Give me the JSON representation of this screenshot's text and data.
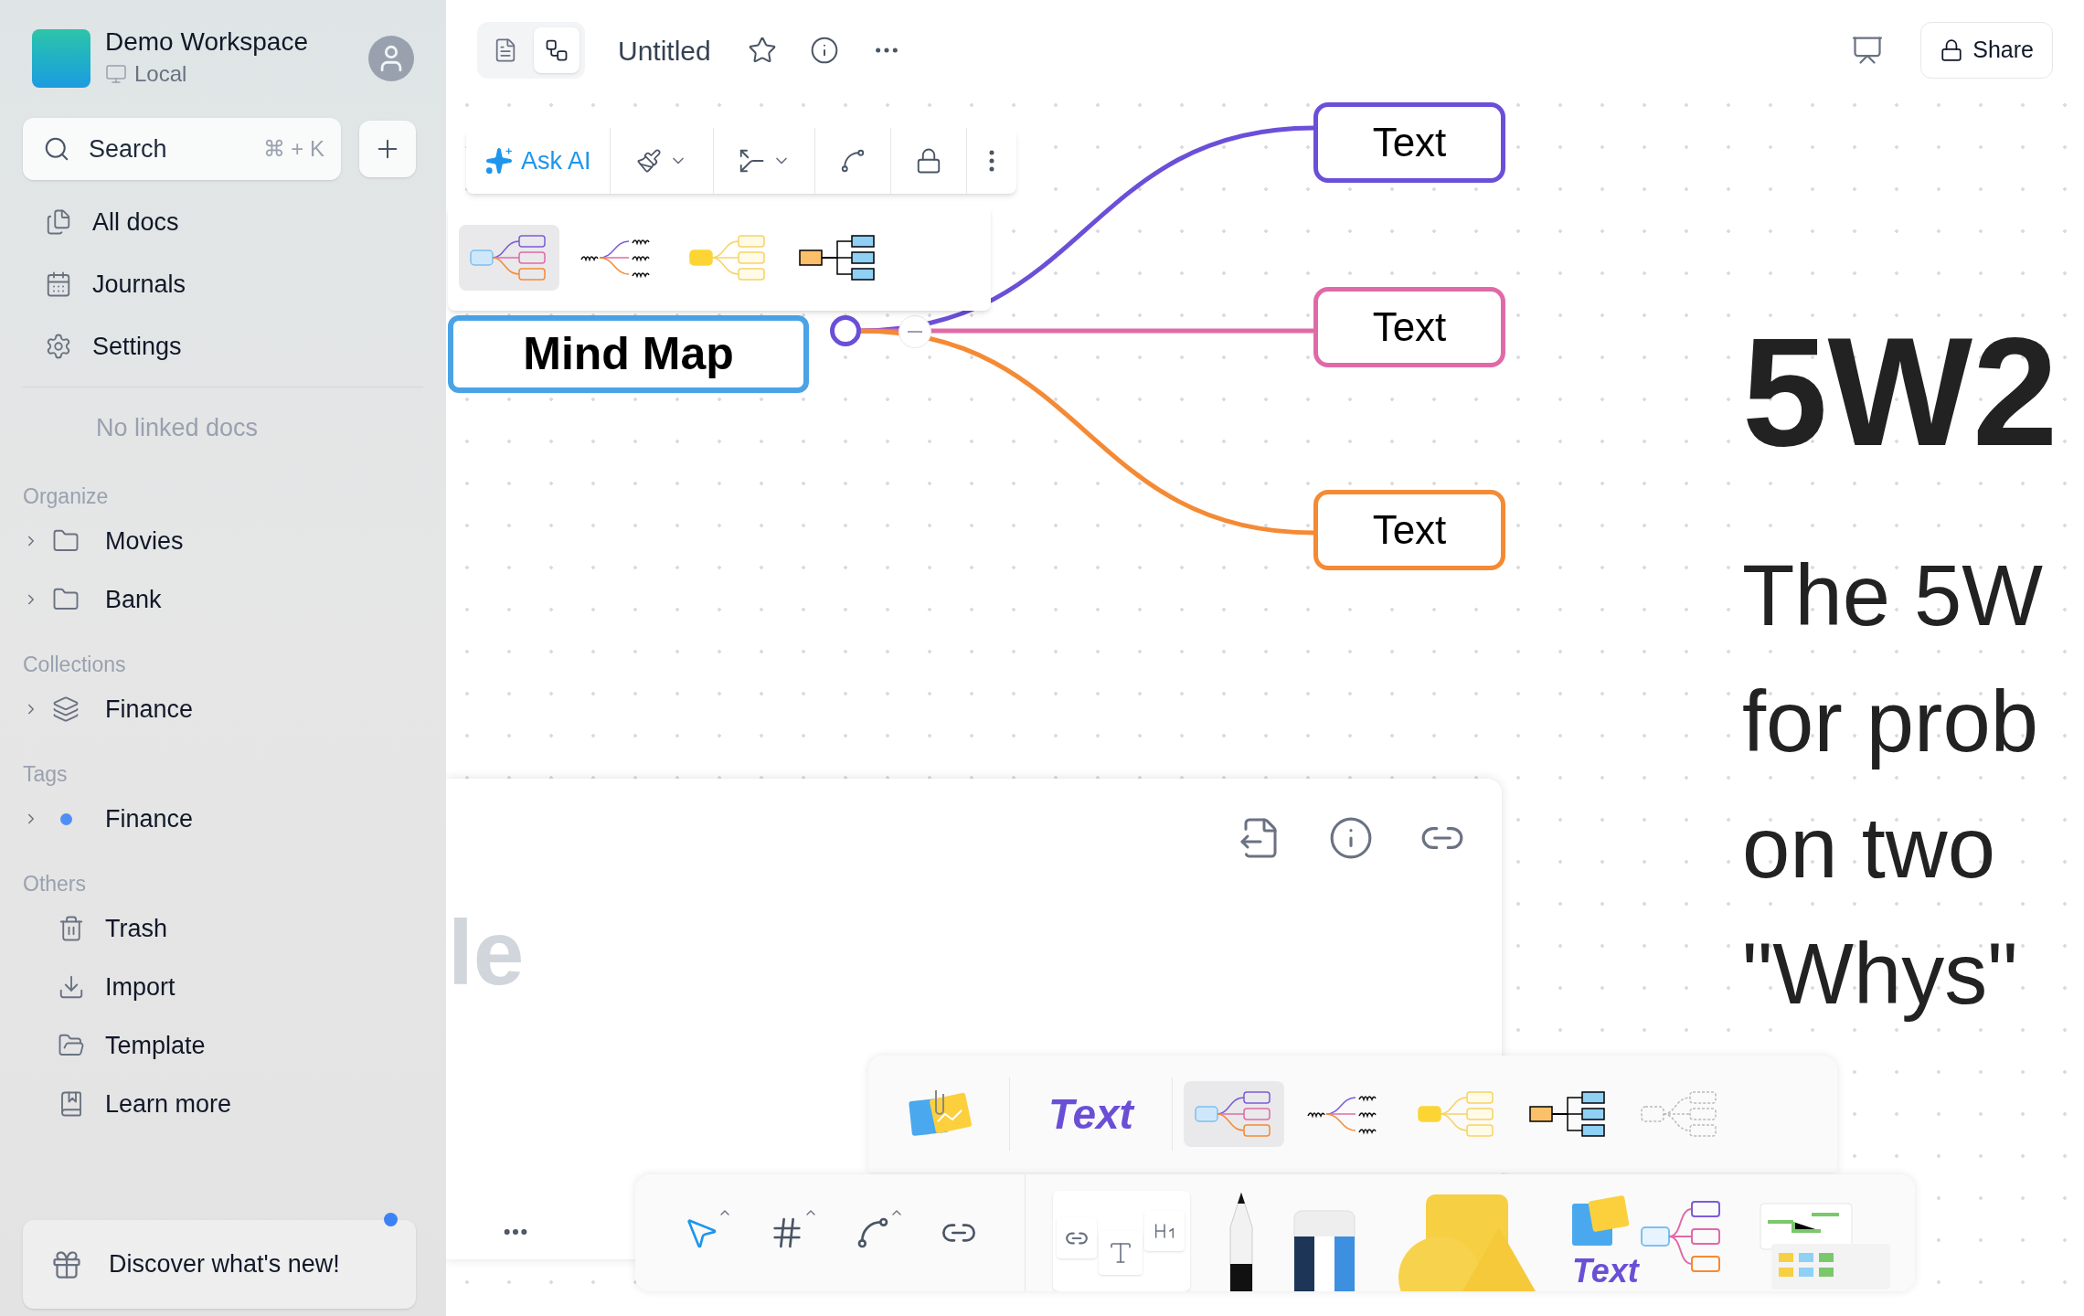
{
  "sidebar": {
    "workspace": {
      "name": "Demo Workspace",
      "storage": "Local"
    },
    "search": {
      "placeholder": "Search",
      "shortcut": "⌘ + K"
    },
    "nav": [
      {
        "kind": "docs",
        "label": "All docs"
      },
      {
        "kind": "journals",
        "label": "Journals"
      },
      {
        "kind": "settings",
        "label": "Settings"
      }
    ],
    "empty_note": "No linked docs",
    "sections": [
      {
        "title": "Organize",
        "items": [
          {
            "kind": "folder",
            "label": "Movies",
            "expanded": false
          },
          {
            "kind": "folder",
            "label": "Bank",
            "expanded": false
          }
        ]
      },
      {
        "title": "Collections",
        "items": [
          {
            "kind": "collection",
            "label": "Finance",
            "expanded": false
          }
        ]
      },
      {
        "title": "Tags",
        "items": [
          {
            "kind": "tag",
            "label": "Finance",
            "expanded": false,
            "color": "#4f8ef7"
          }
        ]
      },
      {
        "title": "Others",
        "items": [
          {
            "kind": "trash",
            "label": "Trash"
          },
          {
            "kind": "import",
            "label": "Import"
          },
          {
            "kind": "template",
            "label": "Template"
          },
          {
            "kind": "guide",
            "label": "Learn more"
          }
        ]
      }
    ],
    "discover": {
      "label": "Discover what's new!",
      "unread": true
    }
  },
  "header": {
    "modes": [
      {
        "kind": "page",
        "selected": false
      },
      {
        "kind": "edgeless",
        "selected": true
      }
    ],
    "title": "Untitled",
    "share": "Share"
  },
  "element_toolbar": {
    "ask_ai": "Ask AI"
  },
  "style_popover": {
    "styles": [
      {
        "kind": "colorful",
        "selected": true
      },
      {
        "kind": "handwritten",
        "selected": false
      },
      {
        "kind": "yellow",
        "selected": false
      },
      {
        "kind": "boxed",
        "selected": false
      }
    ]
  },
  "mind_map": {
    "root": "Mind Map",
    "children": [
      {
        "label": "Text",
        "color": "#6b4fd8"
      },
      {
        "label": "Text",
        "color": "#e06aa8"
      },
      {
        "label": "Text",
        "color": "#f58a34"
      }
    ]
  },
  "note_card": {
    "title_fragment": "le"
  },
  "document": {
    "heading": "5W2",
    "lines": [
      "The 5W",
      "for prob",
      "on two",
      "\"Whys\""
    ]
  },
  "tray": {
    "text_tool": "Text",
    "styles": [
      {
        "kind": "colorful",
        "selected": true
      },
      {
        "kind": "handwritten",
        "selected": false
      },
      {
        "kind": "yellow",
        "selected": false
      },
      {
        "kind": "boxed",
        "selected": false
      },
      {
        "kind": "dashed",
        "selected": false
      }
    ]
  },
  "toolbar": {
    "tools": [
      {
        "kind": "select",
        "selected": true
      },
      {
        "kind": "frame",
        "selected": false
      },
      {
        "kind": "connector",
        "selected": false
      },
      {
        "kind": "link",
        "selected": false
      }
    ],
    "mindmap_label": "Text"
  }
}
